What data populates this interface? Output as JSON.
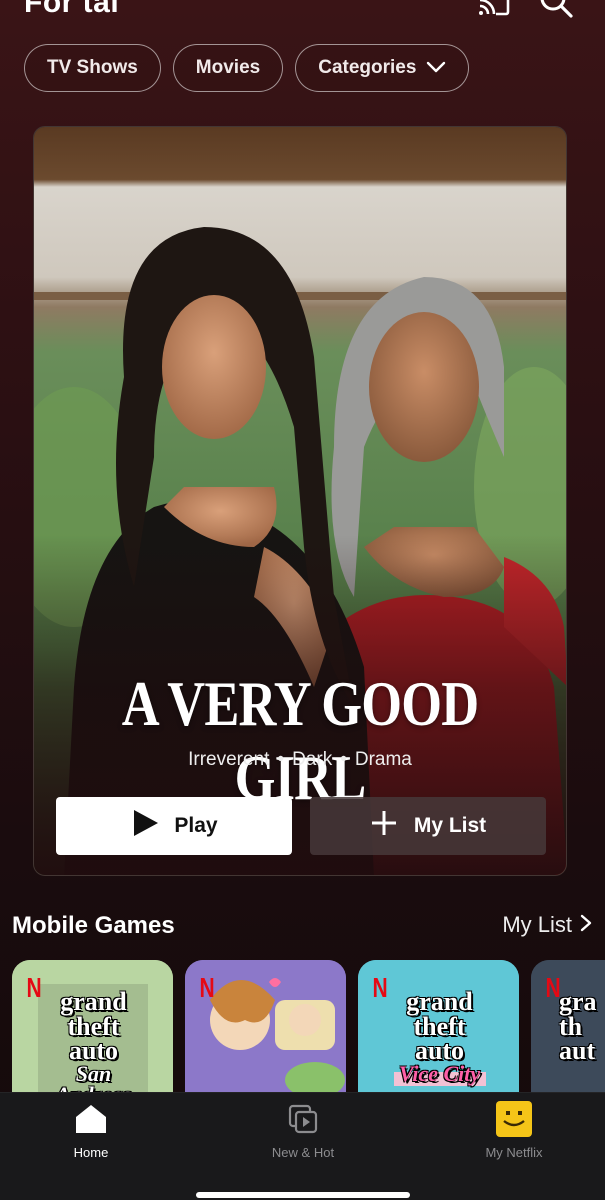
{
  "header": {
    "profile_title": "For tai"
  },
  "chips": [
    {
      "label": "TV Shows"
    },
    {
      "label": "Movies"
    },
    {
      "label": "Categories"
    }
  ],
  "hero": {
    "title": "A VERY GOOD GIRL",
    "tags": [
      "Irreverent",
      "Dark",
      "Drama"
    ],
    "tag_separator": "•",
    "play_label": "Play",
    "mylist_label": "My List"
  },
  "games_row": {
    "title": "Mobile Games",
    "link_label": "My List",
    "tiles": [
      {
        "logo": "N",
        "art_lines": [
          "grand",
          "theft",
          "auto"
        ],
        "subtitle": "San Andreas",
        "bg": "#b9d6a2"
      },
      {
        "logo": "N",
        "art_lines": [],
        "subtitle": "",
        "bg": "#8c78c9"
      },
      {
        "logo": "N",
        "art_lines": [
          "grand",
          "theft",
          "auto"
        ],
        "subtitle": "Vice City",
        "bg": "#5fc7d6"
      },
      {
        "logo": "N",
        "art_lines": [
          "gra",
          "th",
          "aut"
        ],
        "subtitle": "",
        "bg": "#3d4a5a"
      }
    ]
  },
  "bottom_nav": {
    "items": [
      {
        "label": "Home",
        "icon": "home-icon",
        "active": true
      },
      {
        "label": "New & Hot",
        "icon": "new-hot-icon",
        "active": false
      },
      {
        "label": "My Netflix",
        "icon": "avatar-icon",
        "active": false
      }
    ]
  },
  "colors": {
    "accent_red": "#e50914",
    "avatar_yellow": "#f5c518",
    "background": "#2a0f12"
  }
}
